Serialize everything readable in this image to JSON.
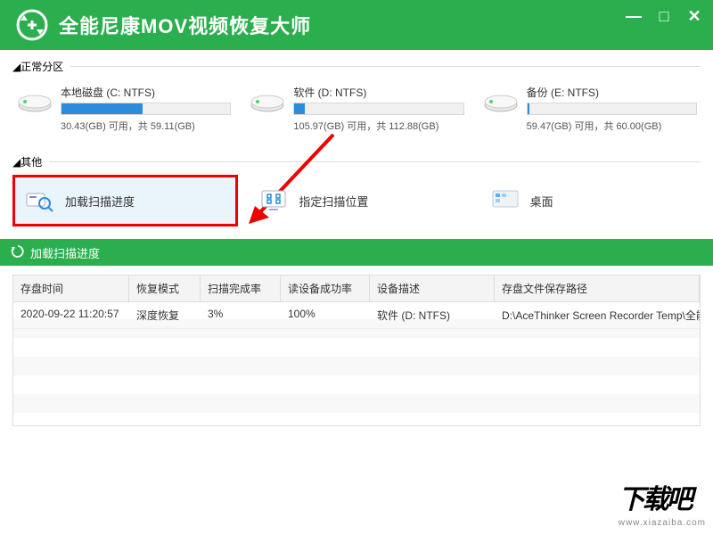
{
  "titlebar": {
    "app_title": "全能尼康MOV视频恢复大师"
  },
  "sections": {
    "normal_partitions": "正常分区",
    "others": "其他"
  },
  "drives": [
    {
      "name": "本地磁盘 (C: NTFS)",
      "fill_percent": 48,
      "stats": "30.43(GB) 可用，共 59.11(GB)"
    },
    {
      "name": "软件 (D: NTFS)",
      "fill_percent": 6,
      "stats": "105.97(GB) 可用，共 112.88(GB)"
    },
    {
      "name": "备份 (E: NTFS)",
      "fill_percent": 1,
      "stats": "59.47(GB) 可用，共 60.00(GB)"
    }
  ],
  "other_items": {
    "load_scan": "加载扫描进度",
    "specify_location": "指定扫描位置",
    "desktop": "桌面"
  },
  "subheader": {
    "title": "加载扫描进度"
  },
  "table": {
    "headers": [
      "存盘时间",
      "恢复模式",
      "扫描完成率",
      "读设备成功率",
      "设备描述",
      "存盘文件保存路径"
    ],
    "rows": [
      {
        "c0": "2020-09-22 11:20:57",
        "c1": "深度恢复",
        "c2": "3%",
        "c3": "100%",
        "c4": "软件 (D: NTFS)",
        "c5": "D:\\AceThinker Screen Recorder Temp\\全能"
      }
    ]
  },
  "watermark": {
    "logo": "下载吧",
    "url": "www.xiazaiba.com"
  }
}
